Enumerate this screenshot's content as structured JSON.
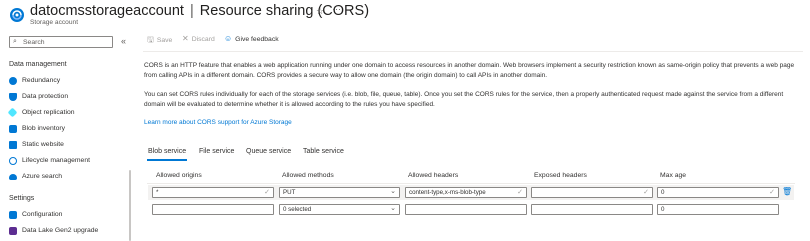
{
  "header": {
    "resource_name": "datocmsstorageaccount",
    "separator": "|",
    "page_name": "Resource sharing (CORS)",
    "subtitle": "Storage account"
  },
  "sidebar": {
    "search_placeholder": "Search",
    "sections": [
      {
        "title": "Data management",
        "items": [
          {
            "label": "Redundancy",
            "icon": "globe-icon",
            "color": "#0078d4"
          },
          {
            "label": "Data protection",
            "icon": "shield-icon",
            "color": "#0078d4"
          },
          {
            "label": "Object replication",
            "icon": "replication-icon",
            "color": "#0078d4"
          },
          {
            "label": "Blob inventory",
            "icon": "inventory-icon",
            "color": "#0078d4"
          },
          {
            "label": "Static website",
            "icon": "website-icon",
            "color": "#0078d4"
          },
          {
            "label": "Lifecycle management",
            "icon": "lifecycle-icon",
            "color": "#0078d4"
          },
          {
            "label": "Azure search",
            "icon": "cloud-search-icon",
            "color": "#0078d4"
          }
        ]
      },
      {
        "title": "Settings",
        "items": [
          {
            "label": "Configuration",
            "icon": "configuration-icon",
            "color": "#0078d4"
          },
          {
            "label": "Data Lake Gen2 upgrade",
            "icon": "upgrade-icon",
            "color": "#5c2d91"
          }
        ]
      }
    ]
  },
  "toolbar": {
    "save_label": "Save",
    "discard_label": "Discard",
    "feedback_label": "Give feedback"
  },
  "description": {
    "para1_line1": "CORS is an HTTP feature that enables a web application running under one domain to access resources in another domain. Web browsers implement a security restriction known as same-origin policy that prevents a web page",
    "para1_line2": "from calling APIs in a different domain. CORS provides a secure way to allow one domain (the origin domain) to call APIs in another domain.",
    "para2_line1": "You can set CORS rules individually for each of the storage services (i.e. blob, file, queue, table). Once you set the CORS rules for the service, then a properly authenticated request made against the service from a different",
    "para2_line2": "domain will be evaluated to determine whether it is allowed according to the rules you have specified.",
    "learn_more": "Learn more about CORS support for Azure Storage"
  },
  "tabs": [
    "Blob service",
    "File service",
    "Queue service",
    "Table service"
  ],
  "table": {
    "columns": [
      "Allowed origins",
      "Allowed methods",
      "Allowed headers",
      "Exposed headers",
      "Max age"
    ],
    "rows": [
      {
        "origins": "*",
        "methods": "PUT",
        "headers": "content-type,x-ms-blob-type",
        "exposed": "",
        "max_age": "0"
      },
      {
        "origins": "",
        "methods": "0 selected",
        "headers": "",
        "exposed": "",
        "max_age": "0"
      }
    ]
  },
  "colors": {
    "accent": "#0078d4",
    "text": "#323130",
    "border": "#8a8886"
  }
}
